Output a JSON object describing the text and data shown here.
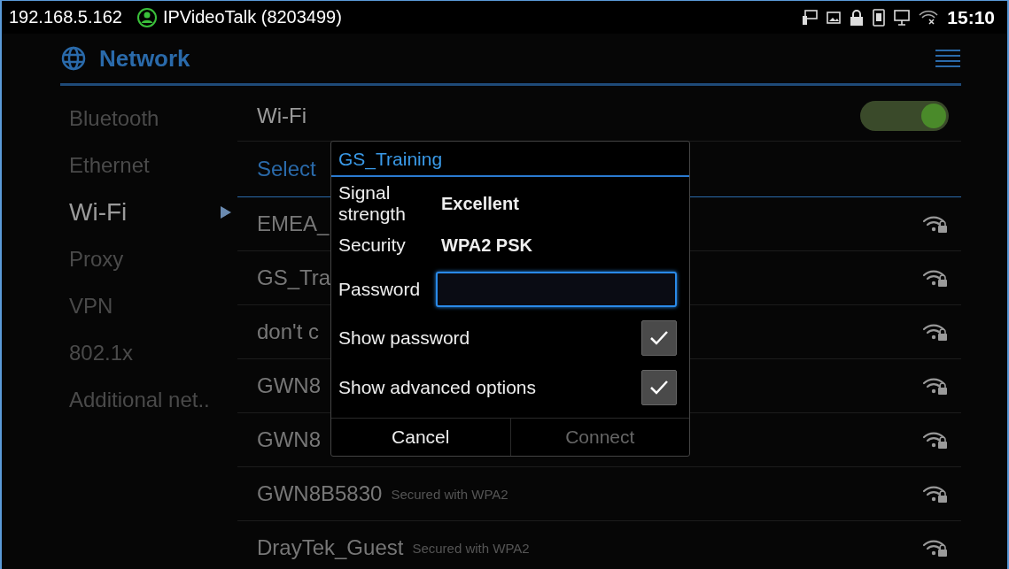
{
  "status_bar": {
    "ip": "192.168.5.162",
    "account": "IPVideoTalk (8203499)",
    "time": "15:10"
  },
  "header": {
    "title": "Network"
  },
  "sidebar": {
    "items": [
      {
        "label": "Bluetooth",
        "selected": false
      },
      {
        "label": "Ethernet",
        "selected": false
      },
      {
        "label": "Wi-Fi",
        "selected": true
      },
      {
        "label": "Proxy",
        "selected": false
      },
      {
        "label": "VPN",
        "selected": false
      },
      {
        "label": "802.1x",
        "selected": false
      },
      {
        "label": "Additional net..",
        "selected": false
      }
    ]
  },
  "wifi": {
    "label": "Wi-Fi",
    "on": true
  },
  "section_header": "Select",
  "networks": [
    {
      "name": "EMEA_"
    },
    {
      "name": "GS_Tra"
    },
    {
      "name": "don't c"
    },
    {
      "name": "GWN8"
    },
    {
      "name": "GWN8"
    },
    {
      "name": "GWN8B5830",
      "security": "Secured with WPA2"
    },
    {
      "name": "DrayTek_Guest",
      "security": "Secured with WPA2"
    }
  ],
  "dialog": {
    "title": "GS_Training",
    "info": [
      {
        "label": "Signal strength",
        "value": "Excellent"
      },
      {
        "label": "Security",
        "value": "WPA2 PSK"
      }
    ],
    "password": {
      "label": "Password"
    },
    "options": [
      {
        "label": "Show password",
        "checked": true
      },
      {
        "label": "Show advanced options",
        "checked": true
      }
    ],
    "buttons": [
      {
        "label": "Cancel",
        "disabled": false
      },
      {
        "label": "Connect",
        "disabled": true
      }
    ]
  }
}
